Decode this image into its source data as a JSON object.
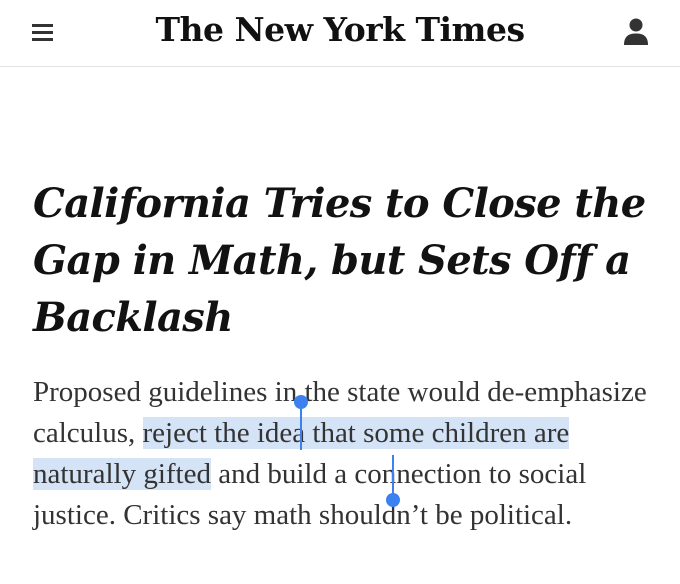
{
  "header": {
    "masthead": "The New York Times",
    "menu_icon": "hamburger-menu-icon",
    "account_icon": "person-account-icon"
  },
  "article": {
    "headline": "California Tries to Close the Gap in Math, but Sets Off a Backlash",
    "summary_before": "Proposed guidelines in the state would de-emphasize calculus, ",
    "summary_selected": "reject the idea that some children are naturally gifted",
    "summary_after": " and build a connection to social justice. Critics say math shouldn’t be political."
  },
  "selection": {
    "highlight_color": "#d5e3f6",
    "handle_color": "#3b82f0"
  }
}
